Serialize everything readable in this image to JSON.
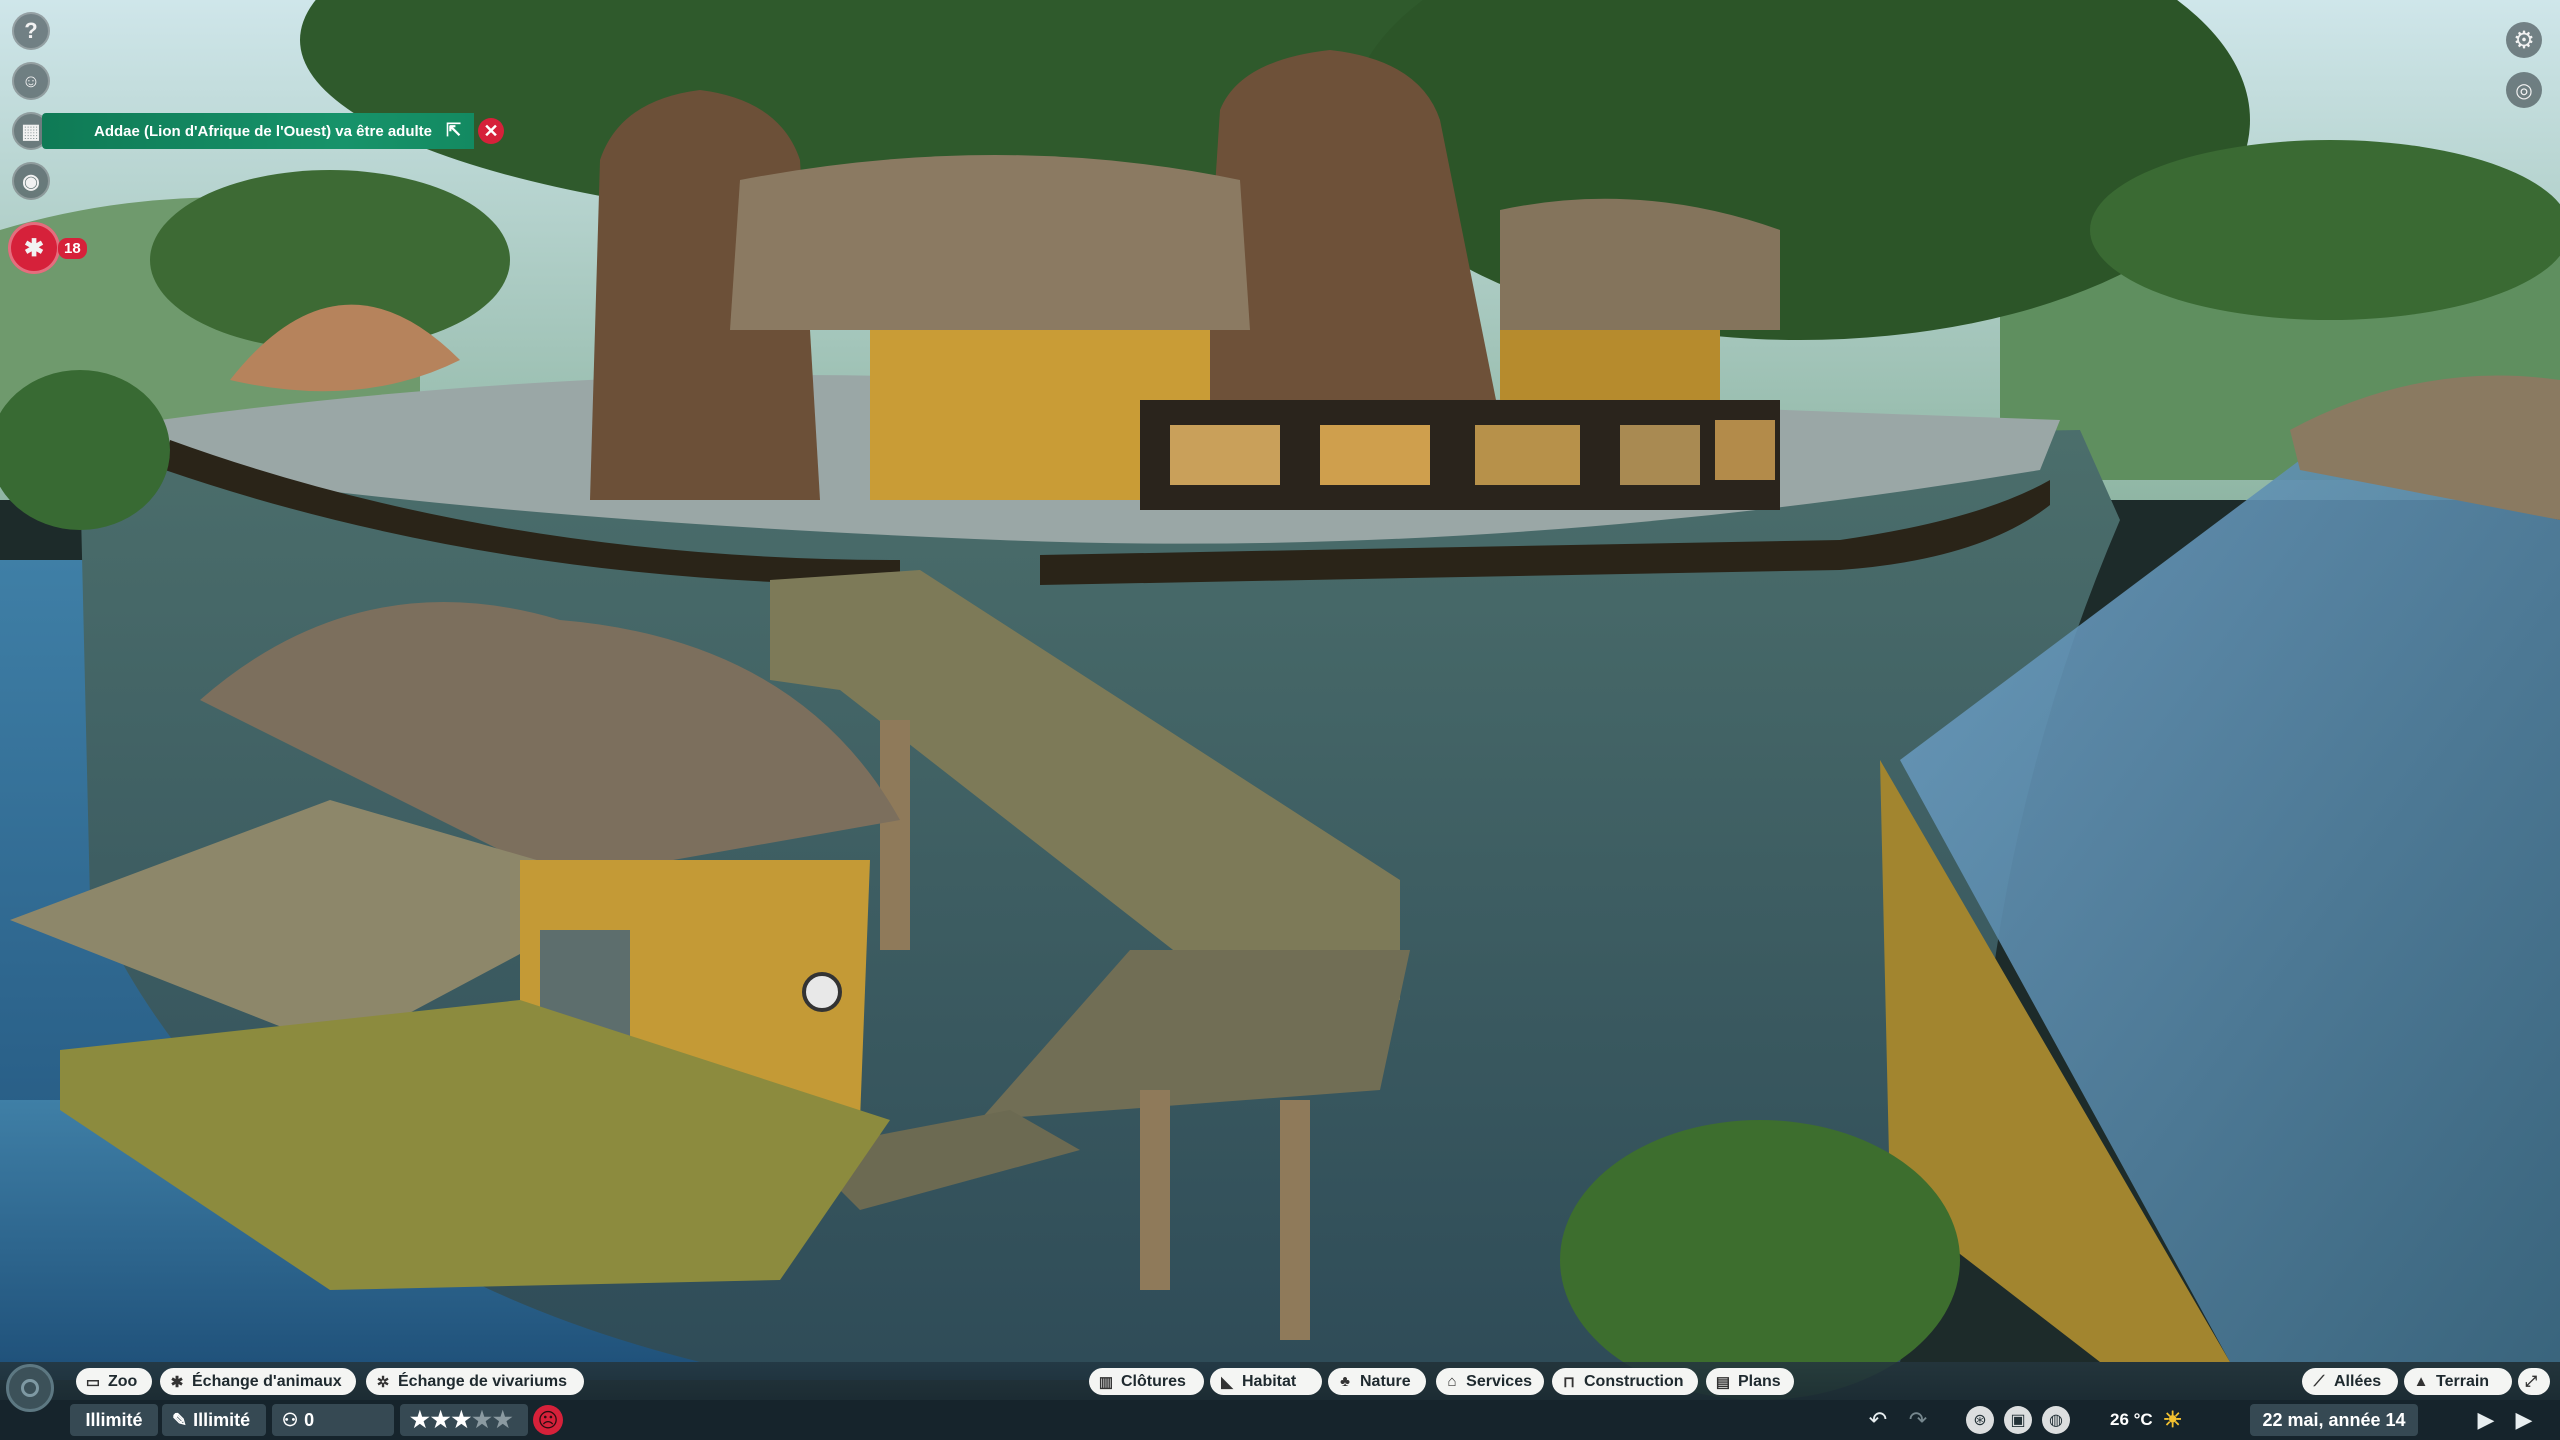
{
  "notification": {
    "message": "Addae (Lion d'Afrique de l'Ouest) va être adulte"
  },
  "side_icons": [
    "help-icon",
    "zookeeper-icon",
    "calendar-icon",
    "eye-icon",
    "paw-icon"
  ],
  "animal_alert_count": "18",
  "top_right_icons": [
    "gear-icon",
    "visibility-icon"
  ],
  "toolbar": {
    "left": [
      {
        "label": "Zoo",
        "icon": "tablet-icon"
      },
      {
        "label": "Échange d'animaux",
        "icon": "paw-icon"
      },
      {
        "label": "Échange de vivariums",
        "icon": "vivarium-icon"
      }
    ],
    "center": [
      {
        "label": "Clôtures",
        "icon": "fence-icon"
      },
      {
        "label": "Habitat",
        "icon": "habitat-icon"
      },
      {
        "label": "Nature",
        "icon": "tree-icon"
      },
      {
        "label": "Services",
        "icon": "shop-icon"
      },
      {
        "label": "Construction",
        "icon": "construction-icon"
      },
      {
        "label": "Plans",
        "icon": "blueprint-icon"
      }
    ],
    "right": [
      {
        "label": "Allées",
        "icon": "path-icon"
      },
      {
        "label": "Terrain",
        "icon": "terrain-icon"
      }
    ]
  },
  "status": {
    "money": "Illimité",
    "research": "Illimité",
    "guests": "0",
    "rating_stars": 3,
    "rating_max": 5,
    "temperature": "26 °C",
    "date": "22 mai, année 14"
  },
  "colors": {
    "accent_green": "#17936a",
    "alert_red": "#d6213a",
    "pill_bg": "#f4f5f3"
  }
}
